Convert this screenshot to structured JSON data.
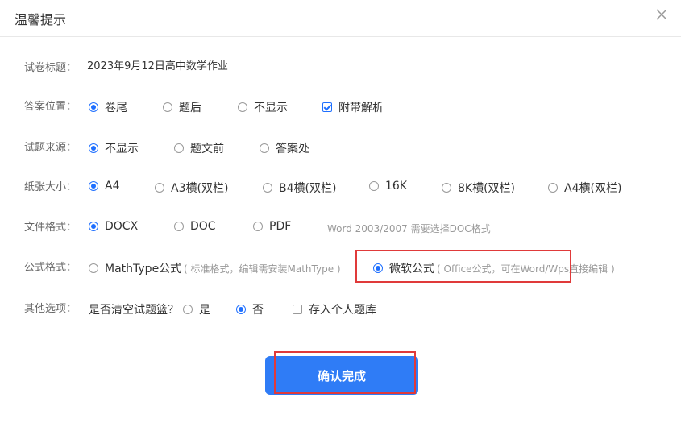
{
  "dialog": {
    "title": "温馨提示",
    "close_icon": "close-icon"
  },
  "paper_title": {
    "label": "试卷标题：",
    "value": "2023年9月12日高中数学作业"
  },
  "answer_position": {
    "label": "答案位置：",
    "options": [
      "卷尾",
      "题后",
      "不显示"
    ],
    "selected": "卷尾",
    "attach_analysis": {
      "label": "附带解析",
      "checked": true
    }
  },
  "source": {
    "label": "试题来源：",
    "options": [
      "不显示",
      "题文前",
      "答案处"
    ],
    "selected": "不显示"
  },
  "paper_size": {
    "label": "纸张大小：",
    "options": [
      "A4",
      "A3横(双栏)",
      "B4横(双栏)",
      "16K",
      "8K横(双栏)",
      "A4横(双栏)"
    ],
    "selected": "A4"
  },
  "file_format": {
    "label": "文件格式：",
    "options": [
      "DOCX",
      "DOC",
      "PDF"
    ],
    "selected": "DOCX",
    "hint": "Word 2003/2007 需要选择DOC格式"
  },
  "formula_format": {
    "label": "公式格式：",
    "mathtype": {
      "label": "MathType公式",
      "hint": "( 标准格式，编辑需安装MathType )"
    },
    "office": {
      "label": "微软公式",
      "hint": "( Office公式，可在Word/Wps直接编辑 )"
    },
    "selected": "微软公式"
  },
  "other": {
    "label": "其他选项：",
    "clear_question": "是否清空试题篮？",
    "yes": "是",
    "no": "否",
    "selected": "否",
    "save_personal": {
      "label": "存入个人题库",
      "checked": false
    }
  },
  "confirm_button": "确认完成",
  "colors": {
    "accent": "#2f7cf6",
    "highlight": "#e03a3a"
  }
}
